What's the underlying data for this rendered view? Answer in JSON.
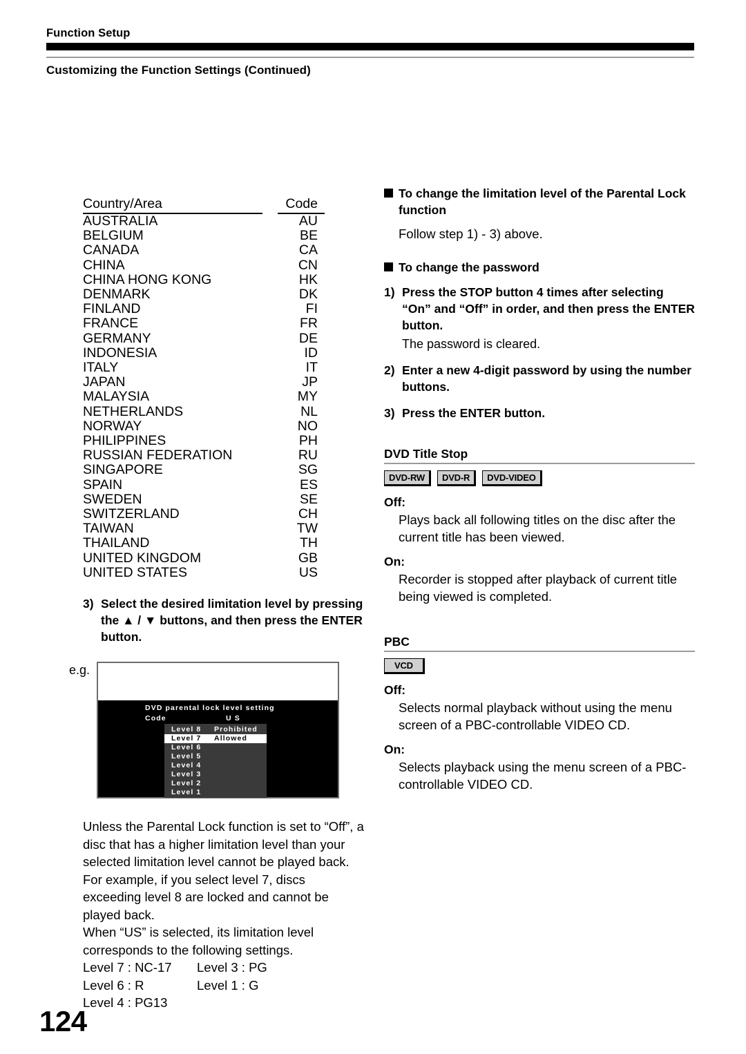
{
  "header": {
    "title": "Function Setup",
    "subtitle": "Customizing the Function Settings (Continued)"
  },
  "country_table": {
    "col_country": "Country/Area",
    "col_code": "Code",
    "rows": [
      {
        "country": "AUSTRALIA",
        "code": "AU"
      },
      {
        "country": "BELGIUM",
        "code": "BE"
      },
      {
        "country": "CANADA",
        "code": "CA"
      },
      {
        "country": "CHINA",
        "code": "CN"
      },
      {
        "country": "CHINA HONG KONG",
        "code": "HK"
      },
      {
        "country": "DENMARK",
        "code": "DK"
      },
      {
        "country": "FINLAND",
        "code": "FI"
      },
      {
        "country": "FRANCE",
        "code": "FR"
      },
      {
        "country": "GERMANY",
        "code": "DE"
      },
      {
        "country": "INDONESIA",
        "code": "ID"
      },
      {
        "country": "ITALY",
        "code": "IT"
      },
      {
        "country": "JAPAN",
        "code": "JP"
      },
      {
        "country": "MALAYSIA",
        "code": "MY"
      },
      {
        "country": "NETHERLANDS",
        "code": "NL"
      },
      {
        "country": "NORWAY",
        "code": "NO"
      },
      {
        "country": "PHILIPPINES",
        "code": "PH"
      },
      {
        "country": "RUSSIAN FEDERATION",
        "code": "RU"
      },
      {
        "country": "SINGAPORE",
        "code": "SG"
      },
      {
        "country": "SPAIN",
        "code": "ES"
      },
      {
        "country": "SWEDEN",
        "code": "SE"
      },
      {
        "country": "SWITZERLAND",
        "code": "CH"
      },
      {
        "country": "TAIWAN",
        "code": "TW"
      },
      {
        "country": "THAILAND",
        "code": "TH"
      },
      {
        "country": "UNITED KINGDOM",
        "code": "GB"
      },
      {
        "country": "UNITED STATES",
        "code": "US"
      }
    ]
  },
  "step3": {
    "number": "3)",
    "text": "Select the desired limitation level by pressing the ▲ / ▼ buttons, and then press the ENTER button."
  },
  "example": {
    "label": "e.g.",
    "screen": {
      "title": "DVD parental lock level setting",
      "code_label": "Code",
      "code_value": "U S",
      "levels": [
        {
          "name": "Level 8",
          "state": "Prohibited",
          "selected": false
        },
        {
          "name": "Level 7",
          "state": "Allowed",
          "selected": true
        },
        {
          "name": "Level 6",
          "state": "",
          "selected": false
        },
        {
          "name": "Level 5",
          "state": "",
          "selected": false
        },
        {
          "name": "Level 4",
          "state": "",
          "selected": false
        },
        {
          "name": "Level 3",
          "state": "",
          "selected": false
        },
        {
          "name": "Level 2",
          "state": "",
          "selected": false
        },
        {
          "name": "Level 1",
          "state": "",
          "selected": false
        }
      ]
    }
  },
  "paragraphs": {
    "unless": "Unless the Parental Lock function is set to “Off”, a disc that has a higher limitation level than your selected limitation level cannot be played back. For example, if you select level 7, discs exceeding  level 8 are locked and cannot be played back.",
    "when_us": "When “US” is selected, its limitation level corresponds to the following settings."
  },
  "level_legend": [
    {
      "left": "Level 7 : NC-17",
      "right": "Level 3 : PG"
    },
    {
      "left": "Level 6 : R",
      "right": "Level 1 : G"
    },
    {
      "left": "Level 4 : PG13",
      "right": ""
    }
  ],
  "right_column": {
    "limit_bullet": {
      "heading": "To change the limitation level of the Parental Lock function",
      "body": "Follow step 1) - 3) above."
    },
    "password_bullet": {
      "heading": "To change the password",
      "steps": [
        {
          "number": "1)",
          "text": "Press the STOP button 4 times after selecting “On” and “Off” in order, and then press the ENTER button.",
          "note": "The password is cleared."
        },
        {
          "number": "2)",
          "text": "Enter a new 4-digit password by using the number buttons.",
          "note": ""
        },
        {
          "number": "3)",
          "text": "Press the ENTER button.",
          "note": ""
        }
      ]
    },
    "dvd_title_stop": {
      "title": "DVD Title Stop",
      "badges": [
        "DVD-RW",
        "DVD-R",
        "DVD-VIDEO"
      ],
      "off_label": "Off:",
      "off_text": "Plays back all following titles on the disc after the current title has been viewed.",
      "on_label": "On:",
      "on_text": "Recorder is stopped after playback of current title being viewed is completed."
    },
    "pbc": {
      "title": "PBC",
      "badges": [
        "VCD"
      ],
      "off_label": "Off:",
      "off_text": "Selects normal playback without using the menu screen of a PBC-controllable VIDEO CD.",
      "on_label": "On:",
      "on_text": "Selects playback using the menu screen of a PBC-controllable VIDEO CD."
    }
  },
  "page_number": "124",
  "colors": {
    "rule_gray": "#9a9a9a",
    "badge_fill": "#d0d0d0",
    "screen_black": "#000000",
    "menu_panel": "#3a3a3a"
  }
}
